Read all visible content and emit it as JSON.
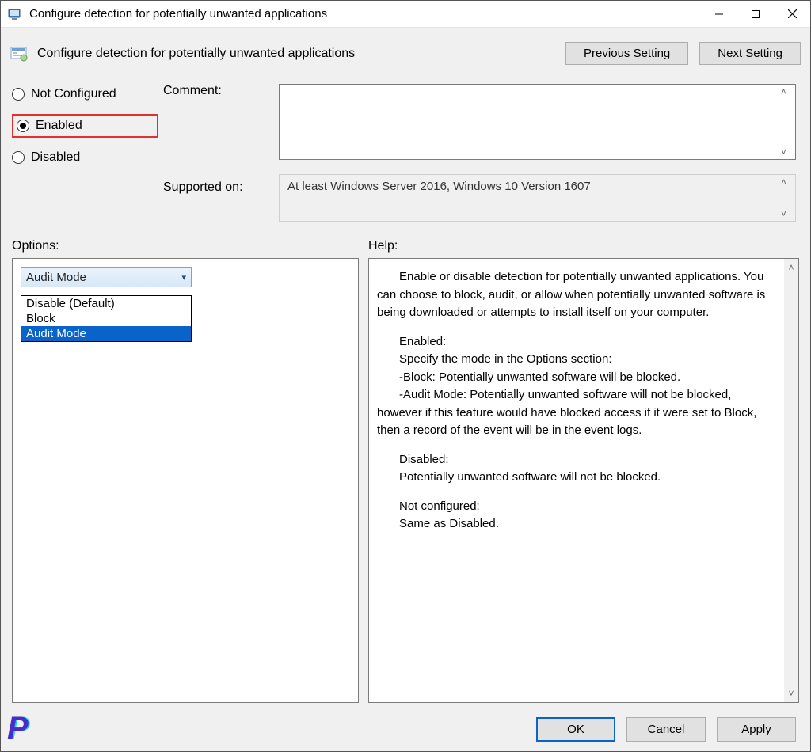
{
  "window": {
    "title": "Configure detection for potentially unwanted applications"
  },
  "header": {
    "title": "Configure detection for potentially unwanted applications",
    "prev": "Previous Setting",
    "next": "Next Setting"
  },
  "radios": {
    "not_configured": "Not Configured",
    "enabled": "Enabled",
    "disabled": "Disabled",
    "selected": "enabled"
  },
  "labels": {
    "comment": "Comment:",
    "supported_on": "Supported on:",
    "options": "Options:",
    "help": "Help:"
  },
  "supported_on": "At least Windows Server 2016, Windows 10 Version 1607",
  "dropdown": {
    "value": "Audit Mode",
    "items": [
      "Disable (Default)",
      "Block",
      "Audit Mode"
    ],
    "selected_index": 2
  },
  "help": {
    "p1": "Enable or disable detection for potentially unwanted applications. You can choose to block, audit, or allow when potentially unwanted software is being downloaded or attempts to install itself on your computer.",
    "h_enabled": "Enabled:",
    "p2": "Specify the mode in the Options section:",
    "p3": "-Block: Potentially unwanted software will be blocked.",
    "p4": "-Audit Mode: Potentially unwanted software will not be blocked, however if this feature would have blocked access if it were set to Block, then a record of the event will be in the event logs.",
    "h_disabled": "Disabled:",
    "p5": "Potentially unwanted software will not be blocked.",
    "h_nc": "Not configured:",
    "p6": "Same as Disabled."
  },
  "buttons": {
    "ok": "OK",
    "cancel": "Cancel",
    "apply": "Apply"
  },
  "logo": "P"
}
